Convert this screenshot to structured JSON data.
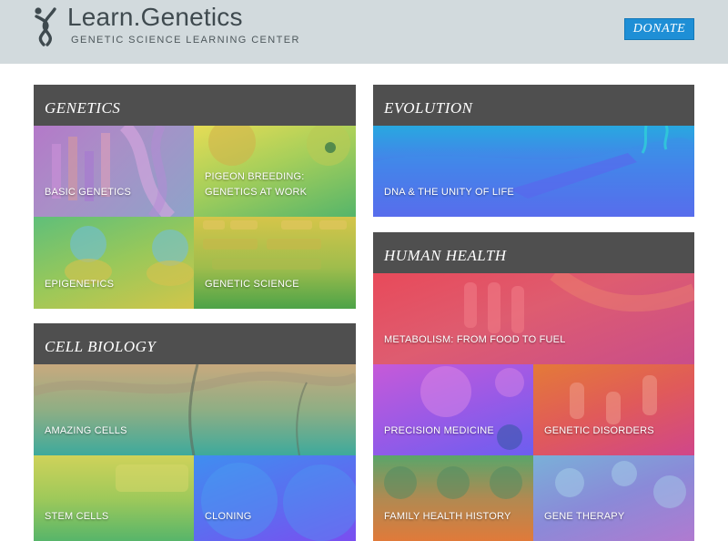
{
  "header": {
    "logo_title": "Learn.Genetics",
    "logo_subtitle": "GENETIC SCIENCE LEARNING CENTER",
    "donate_label": "DONATE"
  },
  "panels": {
    "genetics": {
      "title": "GENETICS",
      "tiles": [
        {
          "label": "BASIC GENETICS"
        },
        {
          "label_line1": "PIGEON BREEDING:",
          "label_line2": "GENETICS AT WORK"
        },
        {
          "label": "EPIGENETICS"
        },
        {
          "label": "GENETIC SCIENCE"
        }
      ]
    },
    "cell_biology": {
      "title": "CELL BIOLOGY",
      "tiles": [
        {
          "label": "AMAZING CELLS"
        },
        {
          "label": "STEM CELLS"
        },
        {
          "label": "CLONING"
        }
      ]
    },
    "evolution": {
      "title": "EVOLUTION",
      "tiles": [
        {
          "label": "DNA & THE UNITY OF LIFE"
        }
      ]
    },
    "human_health": {
      "title": "HUMAN HEALTH",
      "tiles": [
        {
          "label": "METABOLISM: FROM FOOD TO FUEL"
        },
        {
          "label": "PRECISION MEDICINE"
        },
        {
          "label": "GENETIC DISORDERS"
        },
        {
          "label": "FAMILY HEALTH HISTORY"
        },
        {
          "label": "GENE THERAPY"
        }
      ]
    }
  },
  "colors": {
    "header_bg": "#d2dadd",
    "panel_header_bg": "#4f4f4f",
    "donate_bg": "#1e8fd6"
  }
}
